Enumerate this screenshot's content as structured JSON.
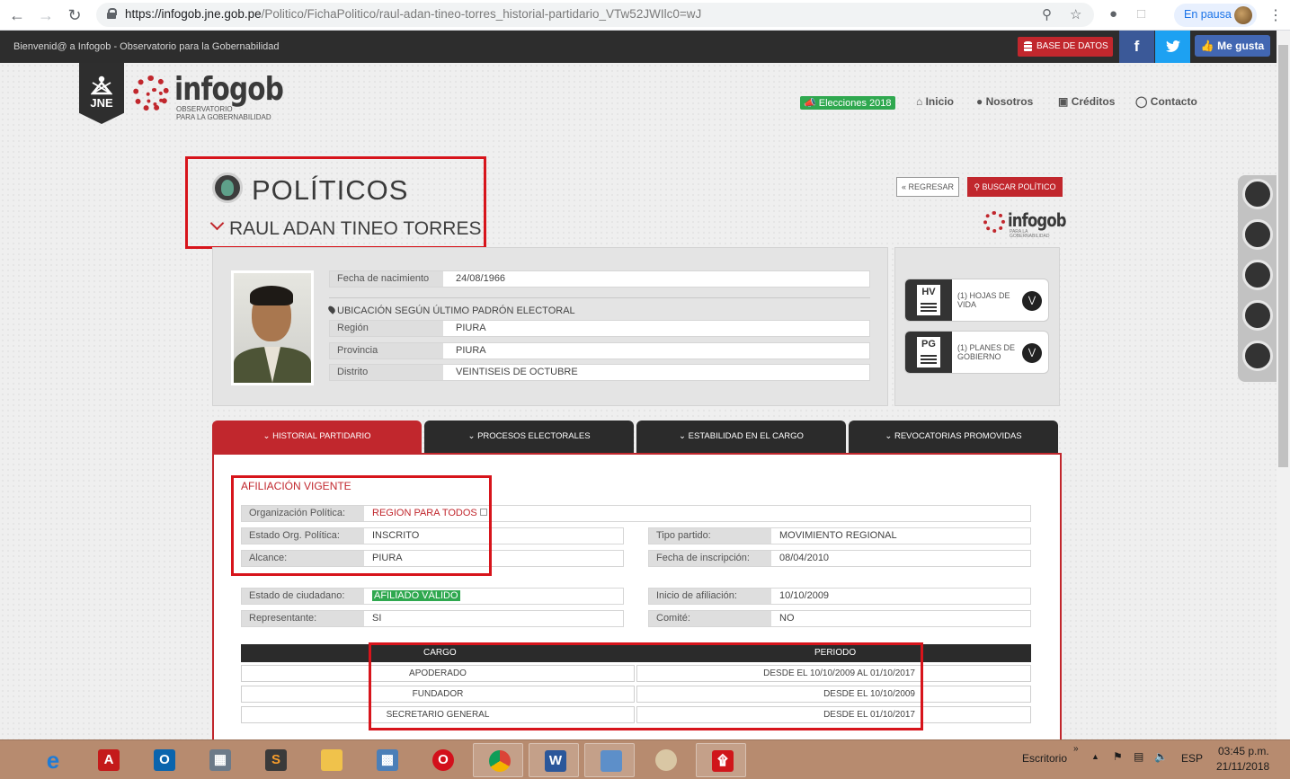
{
  "browser": {
    "url_domain": "https://infogob.jne.gob.pe",
    "url_path": "/Politico/FichaPolitico/raul-adan-tineo-torres_historial-partidario_VTw52JWIlc0=wJ",
    "pause_label": "En pausa"
  },
  "topbar": {
    "welcome": "Bienvenid@ a Infogob - Observatorio para la Gobernabilidad",
    "database_button": "BASE DE DATOS",
    "facebook": "f",
    "like_button": "Me gusta"
  },
  "header": {
    "jne": "JNE",
    "logo_word": "infogob",
    "logo_sub_1": "OBSERVATORIO",
    "logo_sub_2": "PARA LA GOBERNABILIDAD",
    "nav": {
      "elections": "Elecciones 2018",
      "home": "Inicio",
      "about": "Nosotros",
      "credits": "Créditos",
      "contact": "Contacto"
    }
  },
  "profile": {
    "section_title": "POLÍTICOS",
    "name": "RAUL ADAN TINEO TORRES",
    "back_button": "REGRESAR",
    "search_button": "BUSCAR POLÍTICO",
    "birth_label": "Fecha de nacimiento",
    "birth_value": "24/08/1966",
    "location_heading": "UBICACIÓN SEGÚN ÚLTIMO PADRÓN ELECTORAL",
    "region_label": "Región",
    "region_value": "PIURA",
    "province_label": "Provincia",
    "province_value": "PIURA",
    "district_label": "Distrito",
    "district_value": "VEINTISEIS DE OCTUBRE",
    "hv_code": "HV",
    "hv_label": "(1) HOJAS DE VIDA",
    "pg_code": "PG",
    "pg_label": "(1) PLANES DE GOBIERNO"
  },
  "tabs": [
    {
      "label": "HISTORIAL PARTIDARIO",
      "active": true
    },
    {
      "label": "PROCESOS ELECTORALES",
      "active": false
    },
    {
      "label": "ESTABILIDAD EN EL CARGO",
      "active": false
    },
    {
      "label": "REVOCATORIAS PROMOVIDAS",
      "active": false
    }
  ],
  "affiliation": {
    "title": "AFILIACIÓN VIGENTE",
    "org_label": "Organización Política:",
    "org_value": "REGION PARA TODOS",
    "status_label": "Estado Org. Política:",
    "status_value": "INSCRITO",
    "scope_label": "Alcance:",
    "scope_value": "PIURA",
    "party_type_label": "Tipo partido:",
    "party_type_value": "MOVIMIENTO REGIONAL",
    "reg_date_label": "Fecha de inscripción:",
    "reg_date_value": "08/04/2010",
    "citizen_status_label": "Estado de ciudadano:",
    "citizen_status_value": "AFILIADO VÁLIDO",
    "affil_start_label": "Inicio de afiliación:",
    "affil_start_value": "10/10/2009",
    "rep_label": "Representante:",
    "rep_value": "SI",
    "committee_label": "Comité:",
    "committee_value": "NO"
  },
  "positions_table": {
    "headers": [
      "CARGO",
      "PERIODO"
    ],
    "rows": [
      [
        "APODERADO",
        "DESDE EL 10/10/2009 AL 01/10/2017"
      ],
      [
        "FUNDADOR",
        "DESDE EL 10/10/2009"
      ],
      [
        "SECRETARIO GENERAL",
        "DESDE EL 01/10/2017"
      ]
    ]
  },
  "taskbar": {
    "desktop_label": "Escritorio",
    "lang": "ESP",
    "time": "03:45 p.m.",
    "date": "21/11/2018"
  },
  "colors": {
    "brand_red": "#c1272d",
    "dark": "#2b2b2b",
    "green": "#2fa84f",
    "highlight_box": "#d7141b"
  }
}
